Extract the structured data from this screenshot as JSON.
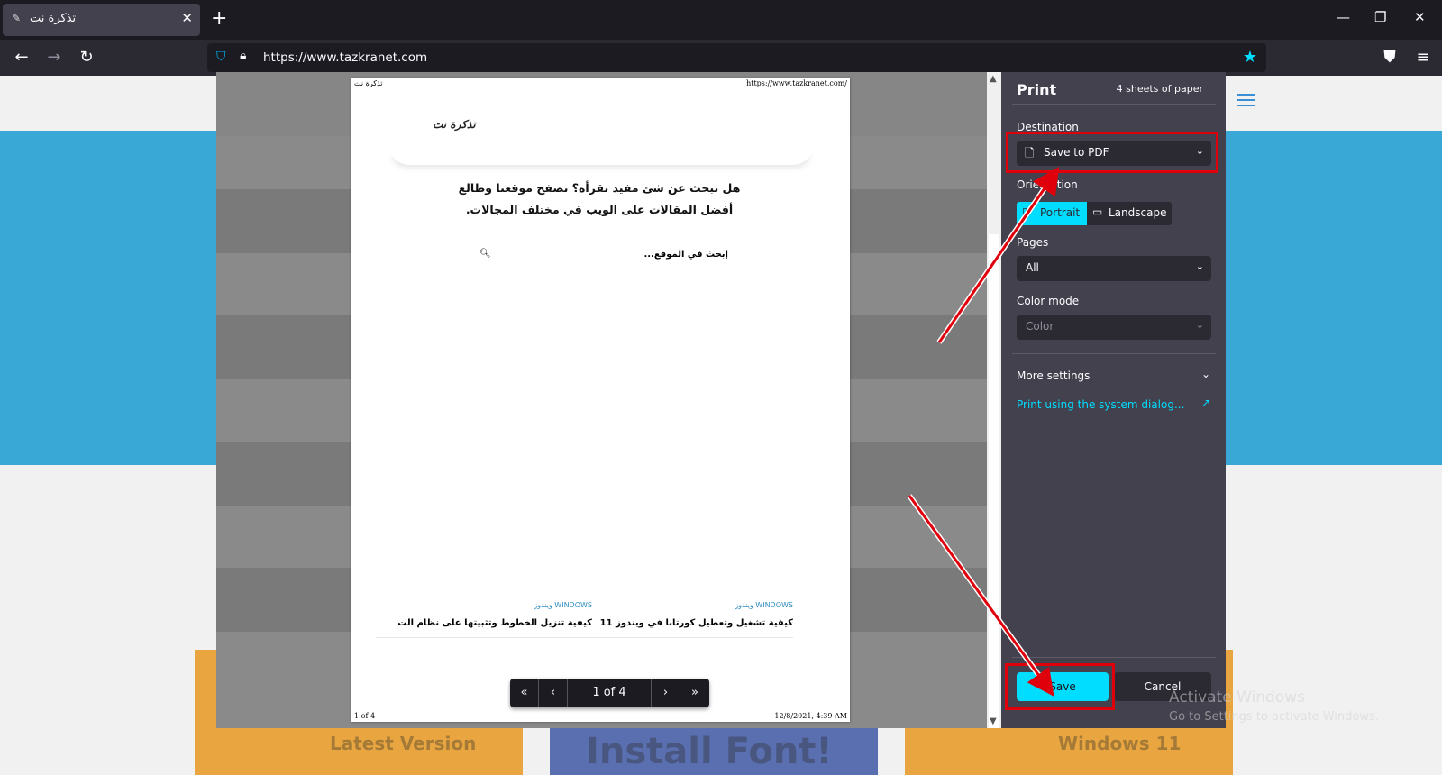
{
  "browser": {
    "tab_title": "تذكرة نت",
    "url": "https://www.tazkranet.com"
  },
  "print_preview": {
    "header_left": "تذكرة نت",
    "header_right": "https://www.tazkranet.com/",
    "footer_left": "1 of 4",
    "footer_right": "12/8/2021, 4:39 AM",
    "logo_text": "تذكرة نت",
    "headline_line1": "هل تبحث عن شئ مفيد تقرأه؟ تصفح موقعنا وطالع",
    "headline_line2": "أفضل المقالات على الويب في مختلف المجالات.",
    "search_placeholder": "إبحث في الموقع...",
    "articles": [
      {
        "category": "WINDOWS ويندوز",
        "title": "كيفية تشغيل وتعطيل كورتانا في ويندوز 11"
      },
      {
        "category": "WINDOWS ويندوز",
        "title": "كيفية تنزيل الخطوط وتثبيتها على نظام الت"
      }
    ],
    "pager": {
      "page_label": "1 of 4"
    }
  },
  "print_panel": {
    "title": "Print",
    "sheets": "4 sheets of paper",
    "destination_label": "Destination",
    "destination_value": "Save to PDF",
    "orientation_label": "Orientation",
    "portrait_label": "Portrait",
    "landscape_label": "Landscape",
    "pages_label": "Pages",
    "pages_value": "All",
    "color_mode_label": "Color mode",
    "color_mode_value": "Color",
    "more_settings": "More settings",
    "system_dialog_link": "Print using the system dialog...",
    "save_button": "Save",
    "cancel_button": "Cancel"
  },
  "background_cards": [
    {
      "text": "Latest Version"
    },
    {
      "text": "Install Font!"
    },
    {
      "text": "Windows 11"
    }
  ],
  "watermark": {
    "line1": "Activate Windows",
    "line2": "Go to Settings to activate Windows."
  },
  "colors": {
    "accent": "#00ddff",
    "highlight": "#e0000b",
    "panel_bg": "#42414d"
  }
}
